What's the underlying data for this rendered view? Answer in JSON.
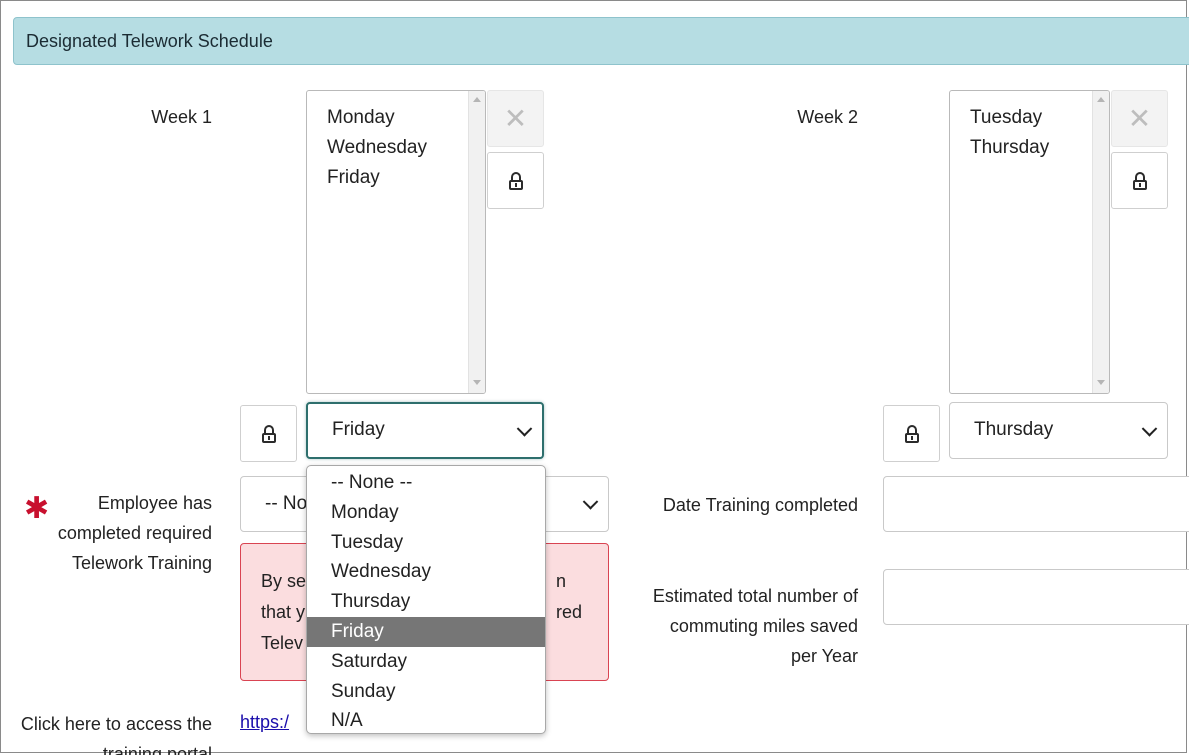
{
  "section": {
    "title": "Designated Telework Schedule"
  },
  "week1": {
    "label": "Week 1",
    "list_items": [
      "Monday",
      "Wednesday",
      "Friday"
    ],
    "select_value": "Friday"
  },
  "week2": {
    "label": "Week 2",
    "list_items": [
      "Tuesday",
      "Thursday"
    ],
    "select_value": "Thursday"
  },
  "training": {
    "required_marker": "✱",
    "label": "Employee has completed required Telework Training",
    "select_value": "-- No",
    "alert_lines": [
      "By se",
      "that y",
      "Telev"
    ],
    "alert_right_lines": [
      "n",
      "red"
    ]
  },
  "date_training": {
    "label": "Date Training completed",
    "value": ""
  },
  "miles": {
    "label": "Estimated total number of commuting miles saved per Year",
    "value": ""
  },
  "portal": {
    "label": "Click here to access the training portal",
    "link_text": "https:/"
  },
  "dropdown": {
    "options": [
      "-- None --",
      "Monday",
      "Tuesday",
      "Wednesday",
      "Thursday",
      "Friday",
      "Saturday",
      "Sunday",
      "N/A"
    ],
    "selected": "Friday"
  },
  "icons": {
    "clear": "close-icon",
    "lock": "lock-icon",
    "chevron": "chevron-down-icon"
  }
}
